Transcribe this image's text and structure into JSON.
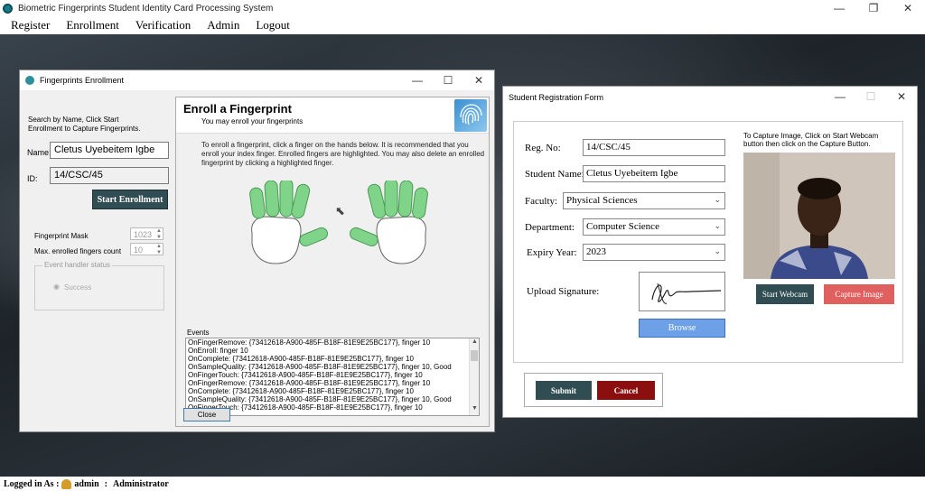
{
  "app": {
    "title": "Biometric Fingerprints Student Identity Card Processing System",
    "menu": [
      "Register",
      "Enrollment",
      "Verification",
      "Admin",
      "Logout"
    ]
  },
  "enroll_window": {
    "title": "Fingerprints Enrollment",
    "search_hint": "Search by Name, Click Start Enrollment to Capture Fingerprints.",
    "name_label": "Name:",
    "name_value": "Cletus Uyebeitem Igbe",
    "id_label": "ID:",
    "id_value": "14/CSC/45",
    "start_button": "Start Enrollment",
    "mask_label": "Fingerprint Mask",
    "mask_value": "1023",
    "max_label": "Max. enrolled fingers count",
    "max_value": "10",
    "event_group": "Event handler status",
    "success_label": "Success",
    "panel_title": "Enroll a Fingerprint",
    "panel_subtitle": "You may enroll your fingerprints",
    "instructions": "To enroll a fingerprint, click a finger on the hands below. It is recommended that you enroll your index finger. Enrolled fingers are highlighted. You may also delete an enrolled fingerprint by clicking a highlighted finger.",
    "events_label": "Events",
    "events": [
      "OnFingerRemove: {73412618-A900-485F-B18F-81E9E25BC177}, finger 10",
      "OnEnroll: finger 10",
      "OnComplete: {73412618-A900-485F-B18F-81E9E25BC177}, finger 10",
      "OnSampleQuality: {73412618-A900-485F-B18F-81E9E25BC177}, finger 10, Good",
      "OnFingerTouch: {73412618-A900-485F-B18F-81E9E25BC177}, finger 10",
      "OnFingerRemove: {73412618-A900-485F-B18F-81E9E25BC177}, finger 10",
      "OnComplete: {73412618-A900-485F-B18F-81E9E25BC177}, finger 10",
      "OnSampleQuality: {73412618-A900-485F-B18F-81E9E25BC177}, finger 10, Good",
      "OnFingerTouch: {73412618-A900-485F-B18F-81E9E25BC177}, finger 10"
    ],
    "close_button": "Close"
  },
  "reg_window": {
    "title": "Student Registration Form",
    "regno_label": "Reg. No:",
    "regno_value": "14/CSC/45",
    "name_label": "Student Name:",
    "name_value": "Cletus Uyebeitem Igbe",
    "faculty_label": "Faculty:",
    "faculty_value": "Physical Sciences",
    "dept_label": "Department:",
    "dept_value": "Computer Science",
    "expiry_label": "Expiry Year:",
    "expiry_value": "2023",
    "signature_label": "Upload Signature:",
    "browse_button": "Browse",
    "camera_note": "To Capture Image, Click on Start Webcam button then click on the Capture Button.",
    "start_webcam": "Start Webcam",
    "capture_image": "Capture Image",
    "submit": "Submit",
    "cancel": "Cancel"
  },
  "status": {
    "logged_in_label": "Logged in As :",
    "user": "admin",
    "separator": ":",
    "role": "Administrator"
  },
  "colors": {
    "finger_enrolled": "#7fd48a",
    "dark_button": "#2f4d52",
    "cancel_button": "#8b0f0f",
    "capture_button": "#e06060",
    "browse_button": "#6ea0e8"
  }
}
